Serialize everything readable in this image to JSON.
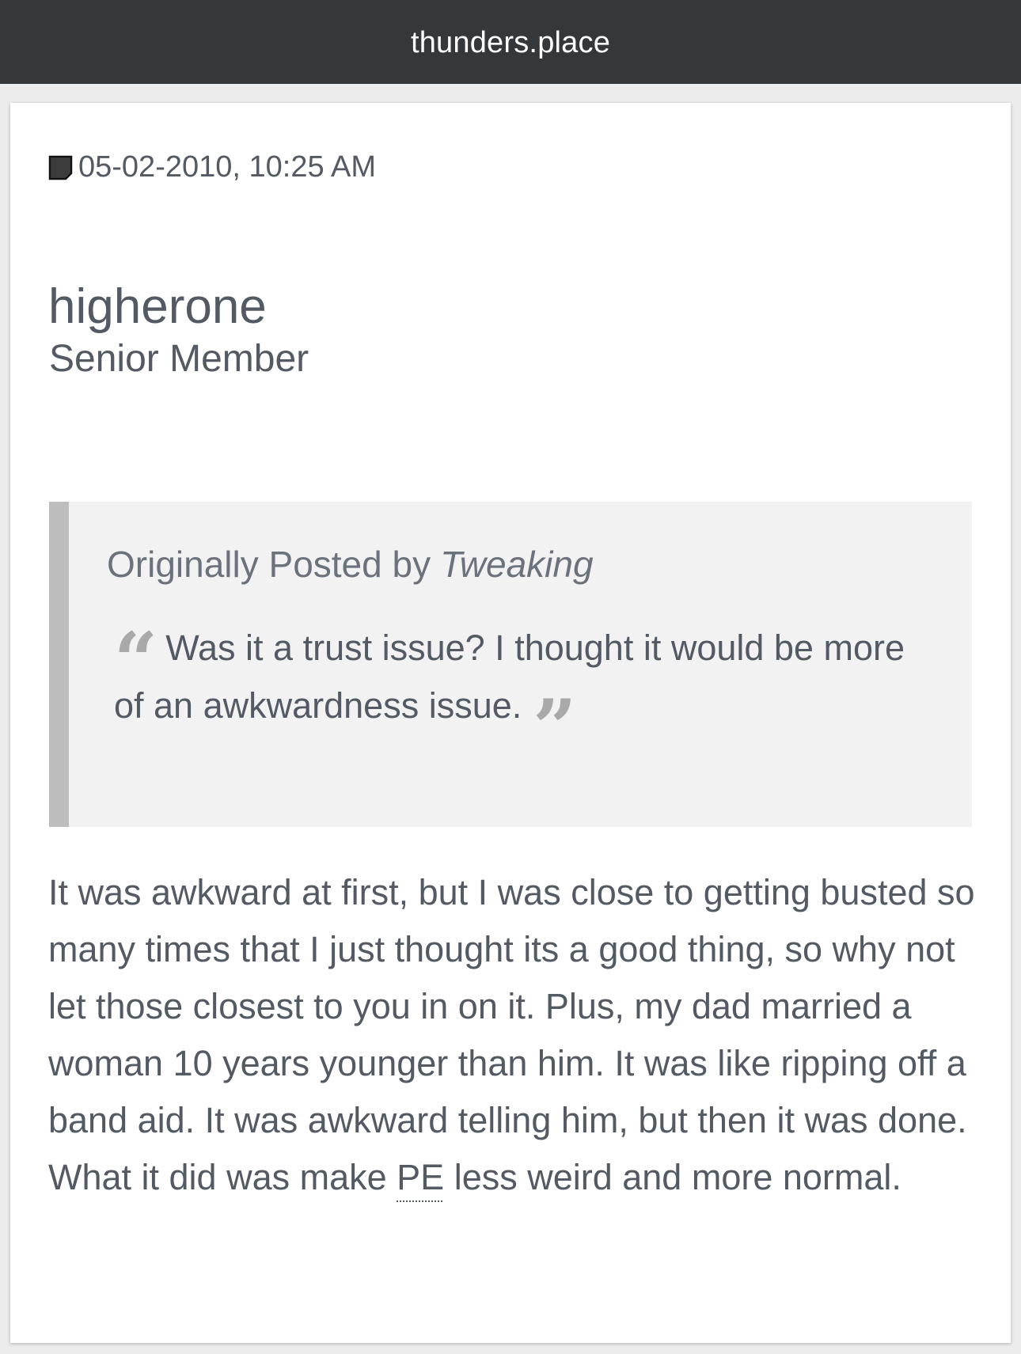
{
  "header": {
    "title": "thunders.place"
  },
  "post": {
    "date": "05-02-2010, 10:25 AM",
    "username": "higherone",
    "user_title": "Senior Member",
    "quote": {
      "label": "Originally Posted by",
      "author": "Tweaking",
      "text": "Was it a trust issue? I thought it would be more of an awkwardness issue."
    },
    "body_before": "It was awkward at first, but I was close to getting busted so many times that I just thought its a good thing, so why not let those closest to you in on it. Plus, my dad married a woman 10 years younger than him. It was like ripping off a band aid. It was awkward telling him, but then it was done. What it did was make ",
    "body_abbr": "PE",
    "body_after": " less weird and more normal."
  },
  "icons": {
    "post_icon": "post-icon"
  }
}
